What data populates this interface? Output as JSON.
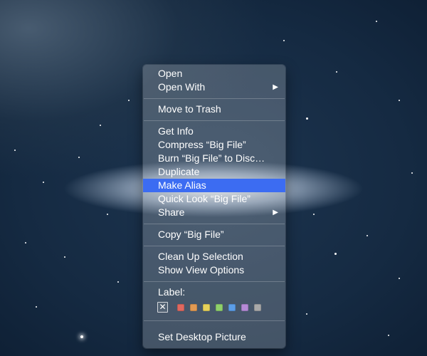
{
  "menu": {
    "open": "Open",
    "open_with": "Open With",
    "move_to_trash": "Move to Trash",
    "get_info": "Get Info",
    "compress": "Compress “Big File”",
    "burn": "Burn “Big File” to Disc…",
    "duplicate": "Duplicate",
    "make_alias": "Make Alias",
    "quick_look": "Quick Look “Big File”",
    "share": "Share",
    "copy": "Copy “Big File”",
    "clean_up": "Clean Up Selection",
    "show_view_options": "Show View Options",
    "label_title": "Label:",
    "label_none_glyph": "✕",
    "label_colors": [
      "#e0685f",
      "#e39a52",
      "#e6d15a",
      "#8fd06a",
      "#5b9de8",
      "#b58ad6",
      "#a9a9a9"
    ],
    "set_desktop_picture": "Set Desktop Picture",
    "submenu_arrow": "▶",
    "highlighted_item": "make_alias"
  },
  "colors": {
    "highlight": "#3c6cf2",
    "menu_text": "#ffffff"
  }
}
